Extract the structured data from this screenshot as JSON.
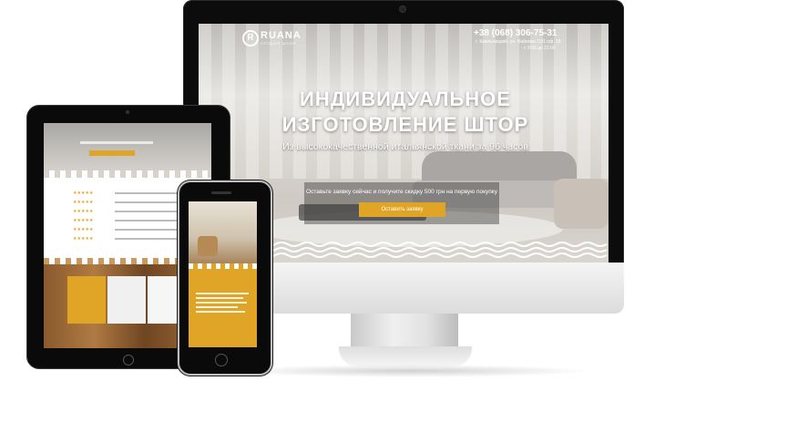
{
  "desktop": {
    "brand": "RUANA",
    "brand_letter": "R",
    "brand_tagline": "СТУДИЯ ШТОР",
    "phone": "+38 (068) 306-75-31",
    "address": "г. Хмельницкий, ул. Вайнова 12/1 оф. 18",
    "hours": "с 9:00 до 21:00",
    "hero_title": "ИНДИВИДУАЛЬНОЕ ИЗГОТОВЛЕНИЕ ШТОР",
    "hero_subtitle": "Из высококачественной итальянской ткани за 96 часов",
    "offer_text": "Оставьте заявку сейчас и получите скидку 500 грн на первую покупку",
    "cta_label": "Оставить заявку"
  },
  "tablet": {
    "list_stars": [
      "★★★★★",
      "★★★★★",
      "★★★★★",
      "★★★★★",
      "★★★★★",
      "★★★★★"
    ],
    "tiles": [
      "",
      "",
      ""
    ]
  },
  "phone": {
    "title_line1": "",
    "title_line2": ""
  },
  "colors": {
    "accent": "#e0a526",
    "device_frame": "#0a0a0a"
  }
}
